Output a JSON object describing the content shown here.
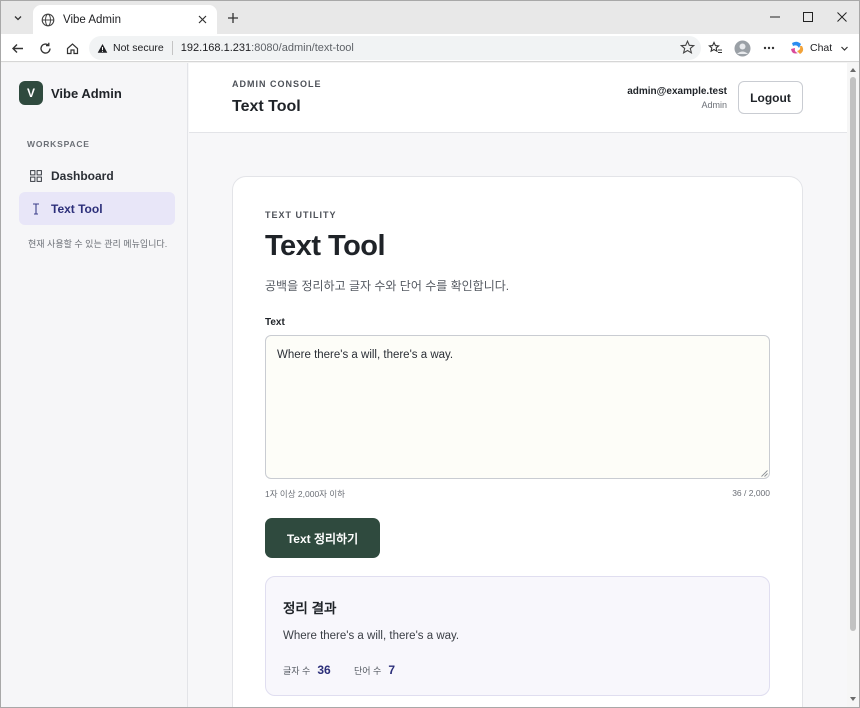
{
  "browser": {
    "tab_title": "Vibe Admin",
    "security_label": "Not secure",
    "url_host": "192.168.1.231",
    "url_path": ":8080/admin/text-tool",
    "chat_label": "Chat"
  },
  "sidebar": {
    "brand_initial": "V",
    "brand_name": "Vibe Admin",
    "section_label": "WORKSPACE",
    "items": [
      {
        "label": "Dashboard",
        "icon": "grid-icon",
        "active": false
      },
      {
        "label": "Text Tool",
        "icon": "text-cursor-icon",
        "active": true
      }
    ],
    "note": "현재 사용할 수 있는 관리 메뉴입니다."
  },
  "header": {
    "eyebrow": "ADMIN CONSOLE",
    "title": "Text Tool",
    "user_email": "admin@example.test",
    "user_role": "Admin",
    "logout_label": "Logout"
  },
  "card": {
    "eyebrow": "TEXT UTILITY",
    "title": "Text Tool",
    "description": "공백을 정리하고 글자 수와 단어 수를 확인합니다.",
    "field_label": "Text",
    "input_value": "Where there's a will, there's a way.",
    "hint": "1자 이상 2,000자 이하",
    "char_count": "36 / 2,000",
    "submit_label": "Text 정리하기"
  },
  "result": {
    "title": "정리 결과",
    "text": "Where there's a will, there's a way.",
    "chars_label": "글자 수",
    "chars_value": "36",
    "words_label": "단어 수",
    "words_value": "7"
  },
  "colors": {
    "brand": "#2f4a3e",
    "accent": "#2c2f7a",
    "active_nav_bg": "#e8e6f8"
  }
}
